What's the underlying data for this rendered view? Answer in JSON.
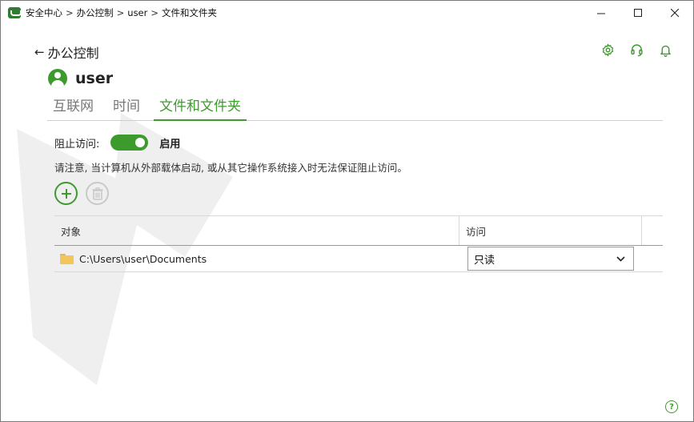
{
  "titlebar": {
    "breadcrumb": [
      "安全中心",
      "办公控制",
      "user",
      "文件和文件夹"
    ],
    "separator": ">"
  },
  "header": {
    "back_label": "办公控制"
  },
  "user": {
    "name": "user"
  },
  "tabs": [
    {
      "label": "互联网",
      "active": false
    },
    {
      "label": "时间",
      "active": false
    },
    {
      "label": "文件和文件夹",
      "active": true
    }
  ],
  "block_access": {
    "label": "阻止访问:",
    "state_label": "启用",
    "enabled": true
  },
  "notice": "请注意, 当计算机从外部载体启动, 或从其它操作系统接入时无法保证阻止访问。",
  "table": {
    "columns": [
      "对象",
      "访问"
    ],
    "rows": [
      {
        "object": "C:\\Users\\user\\Documents",
        "access": "只读"
      }
    ]
  },
  "colors": {
    "accent": "#3d9b2e"
  }
}
